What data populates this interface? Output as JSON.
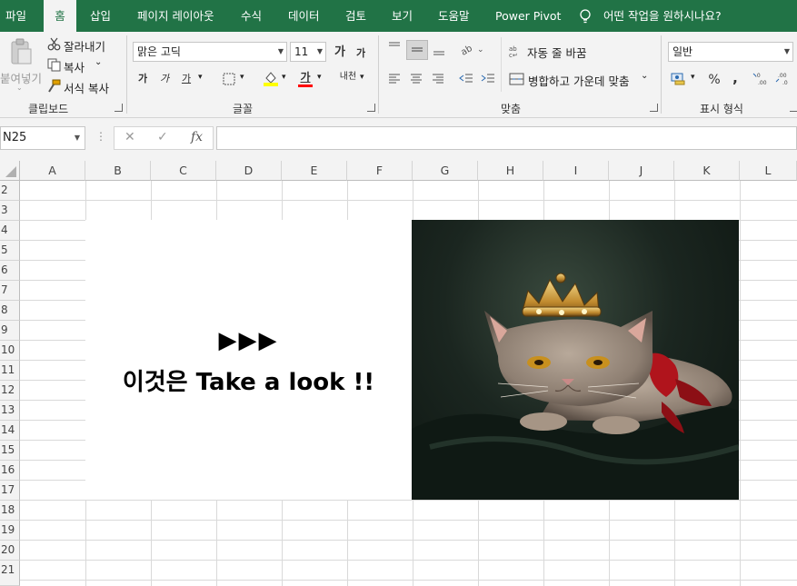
{
  "tabs": [
    "파일",
    "홈",
    "삽입",
    "페이지 레이아웃",
    "수식",
    "데이터",
    "검토",
    "보기",
    "도움말",
    "Power Pivot"
  ],
  "tell_me": "어떤 작업을 원하시나요?",
  "clipboard": {
    "paste": "붙여넣기",
    "cut": "잘라내기",
    "copy": "복사",
    "format_painter": "서식 복사",
    "label": "클립보드"
  },
  "font": {
    "name": "맑은 고딕",
    "size": "11",
    "grow": "가",
    "shrink": "가",
    "bold": "가",
    "italic": "가",
    "underline": "가",
    "font_color_glyph": "가",
    "phonetic": "내천",
    "label": "글꼴"
  },
  "alignment": {
    "wrap_text": "자동 줄 바꿈",
    "merge_center": "병합하고 가운데 맞춤",
    "label": "맞춤"
  },
  "number": {
    "format": "일반",
    "percent": "%",
    "comma": ",",
    "inc_decimal": ".0→.00",
    "dec_decimal": ".00→.0",
    "label": "표시 형식"
  },
  "formula_bar": {
    "name_box": "N25",
    "cancel": "✕",
    "enter": "✓",
    "fx": "fx",
    "formula": ""
  },
  "columns": [
    "A",
    "B",
    "C",
    "D",
    "E",
    "F",
    "G",
    "H",
    "I",
    "J",
    "K",
    "L"
  ],
  "rows": [
    "2",
    "3",
    "4",
    "5",
    "6",
    "7",
    "8",
    "9",
    "10",
    "11",
    "12",
    "13",
    "14",
    "15",
    "16",
    "17",
    "18",
    "19",
    "20",
    "21"
  ],
  "textbox": {
    "arrows": "▶▶▶",
    "text": "이것은 Take a look !!"
  },
  "colors": {
    "excel_green": "#217346",
    "ribbon_bg": "#f3f3f3",
    "fill_color_bar": "#ffff00",
    "font_color_bar": "#ff0000"
  }
}
